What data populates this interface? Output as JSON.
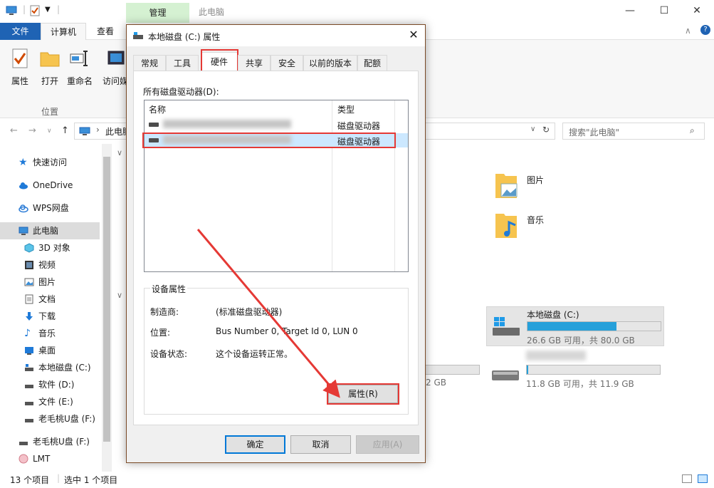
{
  "window": {
    "title": "此电脑",
    "manage_tab": "管理",
    "minimize": "—",
    "maximize": "☐",
    "close": "✕"
  },
  "ribbon": {
    "tabs": [
      "文件",
      "计算机",
      "查看"
    ],
    "buttons": [
      "属性",
      "打开",
      "重命名",
      "访问媒"
    ],
    "group_label": "位置"
  },
  "address": {
    "path": "此电脑",
    "search_placeholder": "搜索\"此电脑\""
  },
  "sidebar": {
    "items": [
      {
        "label": "快速访问",
        "icon": "star-icon"
      },
      {
        "label": "OneDrive",
        "icon": "cloud-icon"
      },
      {
        "label": "WPS网盘",
        "icon": "cloud-icon"
      },
      {
        "label": "此电脑",
        "icon": "computer-icon"
      },
      {
        "label": "3D 对象",
        "icon": "cube-icon"
      },
      {
        "label": "视频",
        "icon": "video-icon"
      },
      {
        "label": "图片",
        "icon": "picture-icon"
      },
      {
        "label": "文档",
        "icon": "document-icon"
      },
      {
        "label": "下载",
        "icon": "download-icon"
      },
      {
        "label": "音乐",
        "icon": "music-icon"
      },
      {
        "label": "桌面",
        "icon": "desktop-icon"
      },
      {
        "label": "本地磁盘 (C:)",
        "icon": "drive-icon"
      },
      {
        "label": "软件 (D:)",
        "icon": "drive-icon"
      },
      {
        "label": "文件 (E:)",
        "icon": "drive-icon"
      },
      {
        "label": "老毛桃U盘 (F:)",
        "icon": "drive-icon"
      },
      {
        "label": "老毛桃U盘 (F:)",
        "icon": "drive-icon"
      },
      {
        "label": "LMT",
        "icon": "folder-icon"
      }
    ]
  },
  "content": {
    "folders": [
      {
        "label": "图片"
      },
      {
        "label": "音乐"
      }
    ],
    "drives": [
      {
        "label": "本地磁盘 (C:)",
        "free": "26.6 GB 可用，共 80.0 GB",
        "usage": 0.67
      },
      {
        "label": "",
        "free": "11.8 GB 可用，共 11.9 GB",
        "usage": 0.01
      }
    ],
    "partial_size": "2 GB"
  },
  "status": {
    "count": "13 个项目",
    "selected": "选中 1 个项目"
  },
  "dialog": {
    "title": "本地磁盘 (C:) 属性",
    "close": "✕",
    "tabs": [
      "常规",
      "工具",
      "硬件",
      "共享",
      "安全",
      "以前的版本",
      "配额"
    ],
    "active_tab": "硬件",
    "drives_label": "所有磁盘驱动器(D):",
    "columns": [
      "名称",
      "类型"
    ],
    "rows": [
      {
        "type": "磁盘驱动器"
      },
      {
        "type": "磁盘驱动器"
      }
    ],
    "props_title": "设备属性",
    "props": [
      {
        "label": "制造商:",
        "value": "(标准磁盘驱动器)"
      },
      {
        "label": "位置:",
        "value": "Bus Number 0, Target Id 0, LUN 0"
      },
      {
        "label": "设备状态:",
        "value": "这个设备运转正常。"
      }
    ],
    "properties_button": "属性(R)",
    "ok": "确定",
    "cancel": "取消",
    "apply": "应用(A)"
  },
  "colors": {
    "accent": "#1f63b4",
    "highlight": "#e53935",
    "progress": "#26a0da",
    "selection": "#cce8ff"
  }
}
